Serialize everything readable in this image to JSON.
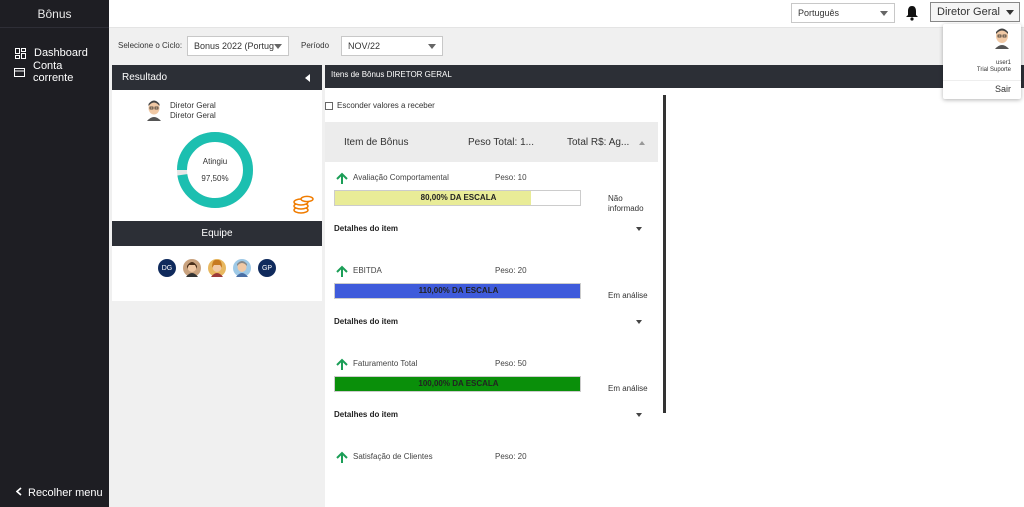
{
  "sidebar": {
    "title": "Bônus",
    "items": [
      {
        "label": "Dashboard",
        "icon": "dashboard-icon"
      },
      {
        "label": "Conta corrente",
        "icon": "card-icon"
      }
    ],
    "footer": "Recolher menu"
  },
  "topbar": {
    "language": "Português",
    "user_button": "Diretor Geral",
    "dropdown": {
      "user": "user1",
      "role": "Trial Suporte",
      "logout": "Sair"
    }
  },
  "filters": {
    "cycle_label": "Selecione o Ciclo:",
    "cycle_value": "Bonus 2022 (Portug",
    "period_label": "Período",
    "period_value": "NOV/22"
  },
  "result": {
    "header": "Resultado",
    "name": "Diretor Geral",
    "role": "Diretor Geral",
    "donut_label": "Atingiu",
    "donut_value": "97,50%",
    "donut_percent": 97.5,
    "donut_color": "#1cbfb0"
  },
  "team": {
    "header": "Equipe",
    "members": [
      {
        "initials": "DG",
        "color": "#0f2a5c"
      },
      {
        "initials": "",
        "color": "#c9a27e"
      },
      {
        "initials": "",
        "color": "#e8b860"
      },
      {
        "initials": "",
        "color": "#9ec9e6"
      },
      {
        "initials": "GP",
        "color": "#0f2a5c"
      }
    ]
  },
  "bonus": {
    "header": "Itens de Bônus DIRETOR GERAL",
    "hide_values": "Esconder valores a receber",
    "columns": [
      "Item de Bônus",
      "Peso Total: 1...",
      "Total R$: Ag..."
    ],
    "details_label": "Detalhes do item",
    "items": [
      {
        "name": "Avaliação Comportamental",
        "peso": "Peso: 10",
        "bar_label": "80,00% DA ESCALA",
        "fill_pct": 80,
        "fill_color": "#e9ec97",
        "status": "Não informado"
      },
      {
        "name": "EBITDA",
        "peso": "Peso: 20",
        "bar_label": "110,00% DA ESCALA",
        "fill_pct": 100,
        "fill_color": "#3f5bdb",
        "status": "Em análise"
      },
      {
        "name": "Faturamento Total",
        "peso": "Peso: 50",
        "bar_label": "100,00% DA ESCALA",
        "fill_pct": 100,
        "fill_color": "#0a8f0a",
        "status": "Em análise"
      },
      {
        "name": "Satisfação de Clientes",
        "peso": "Peso: 20"
      }
    ]
  }
}
